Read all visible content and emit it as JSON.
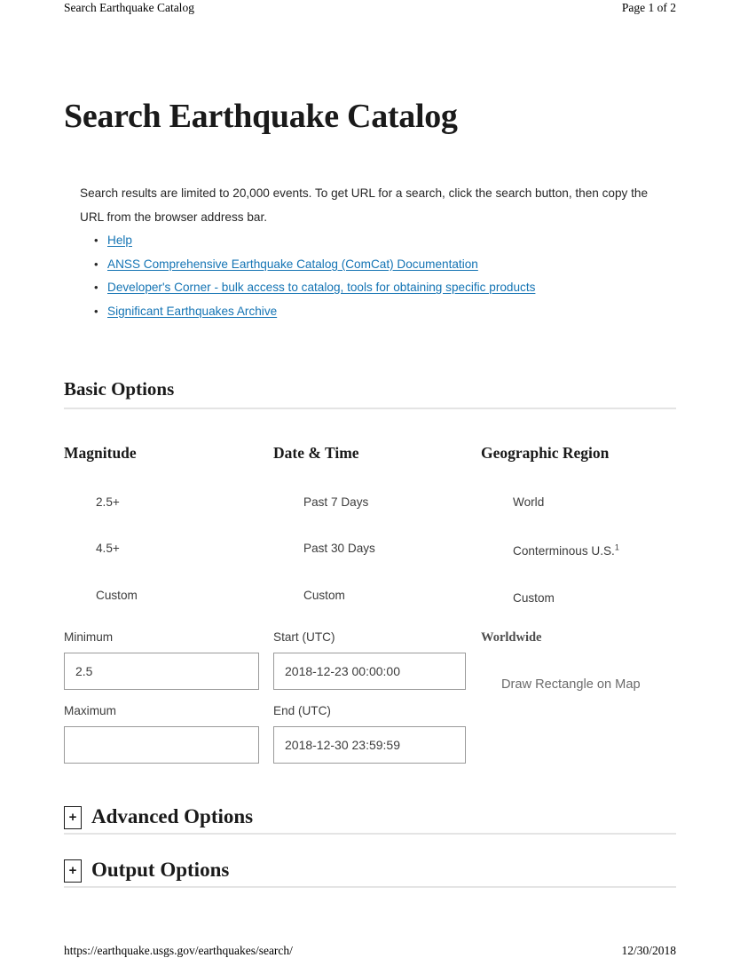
{
  "print_header": {
    "document_title": "Search Earthquake Catalog",
    "page_indicator": "Page 1 of 2"
  },
  "print_footer": {
    "url": "https://earthquake.usgs.gov/earthquakes/search/",
    "date": "12/30/2018"
  },
  "page_title": "Search Earthquake Catalog",
  "intro_paragraph": "Search results are limited to 20,000 events. To get URL for a search, click the search button, then copy the URL from the browser address bar.",
  "links": [
    {
      "label": "Help"
    },
    {
      "label": "ANSS Comprehensive Earthquake Catalog (ComCat) Documentation"
    },
    {
      "label": "Developer's Corner - bulk access to catalog, tools for obtaining specific products"
    },
    {
      "label": "Significant Earthquakes Archive"
    }
  ],
  "basic_options": {
    "heading": "Basic Options",
    "magnitude": {
      "header": "Magnitude",
      "options": [
        "2.5+",
        "4.5+",
        "Custom"
      ],
      "minimum_label": "Minimum",
      "minimum_value": "2.5",
      "maximum_label": "Maximum",
      "maximum_value": ""
    },
    "date_time": {
      "header": "Date & Time",
      "options": [
        "Past 7 Days",
        "Past 30 Days",
        "Custom"
      ],
      "start_label": "Start (UTC)",
      "start_value": "2018-12-23 00:00:00",
      "end_label": "End (UTC)",
      "end_value": "2018-12-30 23:59:59"
    },
    "geographic_region": {
      "header": "Geographic Region",
      "options": [
        "World",
        "Conterminous U.S.",
        "Custom"
      ],
      "conterminous_footnote": "1",
      "sub_label": "Worldwide",
      "draw_button": "Draw Rectangle on Map"
    }
  },
  "collapsible_sections": [
    {
      "toggle": "+",
      "title": "Advanced Options"
    },
    {
      "toggle": "+",
      "title": "Output Options"
    }
  ],
  "colors": {
    "link": "#1474b4",
    "text": "#262626",
    "muted": "#6b6b6b",
    "rule": "#e4e4e4",
    "input_border": "#9a9a9a"
  }
}
